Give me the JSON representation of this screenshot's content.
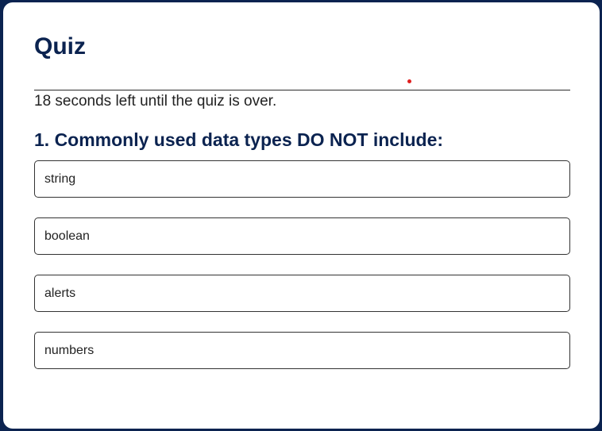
{
  "quiz": {
    "title": "Quiz",
    "timer_text": "18 seconds left until the quiz is over.",
    "question": "1. Commonly used data types DO NOT include:",
    "answers": [
      "string",
      "boolean",
      "alerts",
      "numbers"
    ]
  },
  "colors": {
    "background": "#0b2350",
    "heading": "#0b2350",
    "card": "#ffffff",
    "marker": "#e02020"
  }
}
